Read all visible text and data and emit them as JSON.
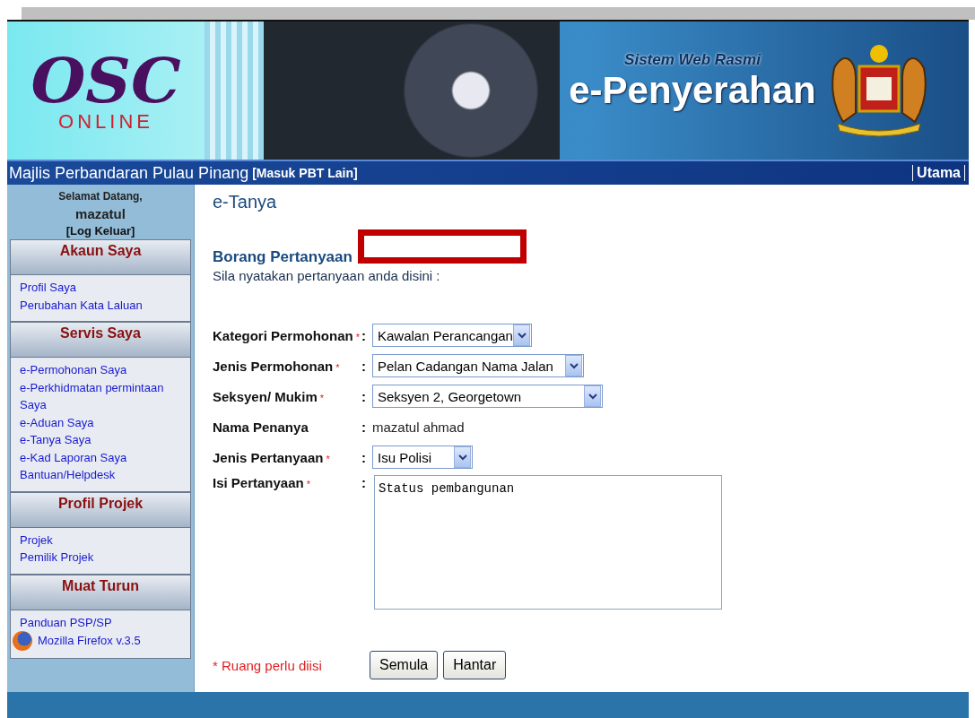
{
  "header": {
    "logo_text": "OSC",
    "logo_subtext": "ONLINE",
    "tagline": "Sistem Web Rasmi",
    "system_name": "e-Penyerahan"
  },
  "navbar": {
    "council": "Majlis Perbandaran Pulau Pinang",
    "switch_link": "[Masuk PBT Lain]",
    "home_link": "Utama"
  },
  "sidebar": {
    "greeting": "Selamat Datang,",
    "username": "mazatul",
    "logout": "[Log Keluar]",
    "sections": [
      {
        "title": "Akaun Saya",
        "items": [
          {
            "kind": "link",
            "label": "Profil Saya"
          },
          {
            "kind": "link",
            "label": "Perubahan Kata Laluan"
          }
        ]
      },
      {
        "title": "Servis Saya",
        "items": [
          {
            "kind": "link",
            "label": "e-Permohonan Saya"
          },
          {
            "kind": "link",
            "label": "e-Perkhidmatan permintaan Saya"
          },
          {
            "kind": "link",
            "label": "e-Aduan Saya"
          },
          {
            "kind": "link",
            "label": "e-Tanya Saya"
          },
          {
            "kind": "link",
            "label": "e-Kad Laporan Saya"
          },
          {
            "kind": "link",
            "label": "Bantuan/Helpdesk"
          }
        ]
      },
      {
        "title": "Profil Projek",
        "items": [
          {
            "kind": "link",
            "label": "Projek"
          },
          {
            "kind": "link",
            "label": "Pemilik Projek"
          }
        ]
      },
      {
        "title": "Muat Turun",
        "items": [
          {
            "kind": "link",
            "label": "Panduan PSP/SP"
          },
          {
            "kind": "browser",
            "label": "Mozilla Firefox v.3.5"
          }
        ]
      }
    ]
  },
  "content": {
    "title": "e-Tanya",
    "form_title": "Borang Pertanyaan",
    "instruction": "Sila nyatakan pertanyaan anda disini :",
    "fields": [
      {
        "kind": "select",
        "label": "Kategori Permohonan",
        "required": true,
        "separator": ":",
        "value": "Kawalan Perancangan"
      },
      {
        "kind": "select",
        "label": "Jenis Permohonan",
        "required": true,
        "separator": ":",
        "value": "Pelan Cadangan Nama Jalan"
      },
      {
        "kind": "select",
        "label": "Seksyen/ Mukim",
        "required": true,
        "separator": ":",
        "value": "Seksyen 2, Georgetown"
      },
      {
        "kind": "text",
        "label": "Nama Penanya",
        "required": false,
        "separator": ":",
        "value": "mazatul ahmad"
      },
      {
        "kind": "select",
        "label": "Jenis Pertanyaan",
        "required": true,
        "separator": ":",
        "value": "Isu Polisi"
      },
      {
        "kind": "textarea",
        "label": "Isi Pertanyaan",
        "required": true,
        "separator": ":",
        "value": "Status pembangunan"
      }
    ],
    "required_mark": "*",
    "required_note": "* Ruang perlu diisi",
    "buttons": [
      "Semula",
      "Hantar"
    ]
  }
}
